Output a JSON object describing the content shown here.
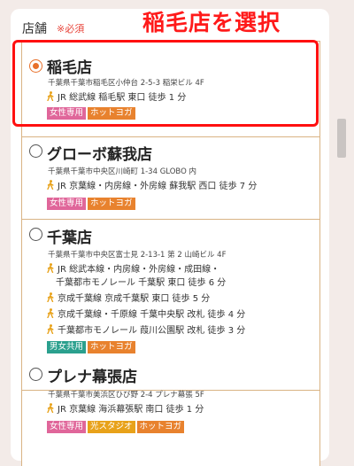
{
  "form": {
    "field_label": "店舗",
    "required_label": "※必須"
  },
  "annotation": "稲毛店を選択",
  "colors": {
    "tag_women": "#e0669a",
    "tag_yoga": "#e8822e",
    "tag_studio": "#e8a21a",
    "tag_mixed": "#2ba08e",
    "border": "#d9b384",
    "radio_selected": "#e8702a",
    "highlight": "#ff1010"
  },
  "stores": [
    {
      "name": "稲毛店",
      "selected": true,
      "address": "千葉県千葉市稲毛区小仲台 2-5-3 稲栄ビル 4F",
      "access": [
        {
          "text": "JR 総武線 稲毛駅 東口 徒歩 1 分",
          "walker": true
        }
      ],
      "tags": [
        {
          "label": "女性専用",
          "color": "tag_women"
        },
        {
          "label": "ホットヨガ",
          "color": "tag_yoga"
        }
      ]
    },
    {
      "name": "グローボ蘇我店",
      "selected": false,
      "address": "千葉県千葉市中央区川崎町 1-34 GLOBO 内",
      "access": [
        {
          "text": "JR 京葉線・内房線・外房線 蘇我駅 西口 徒歩 7 分",
          "walker": true
        }
      ],
      "tags": [
        {
          "label": "女性専用",
          "color": "tag_women"
        },
        {
          "label": "ホットヨガ",
          "color": "tag_yoga"
        }
      ]
    },
    {
      "name": "千葉店",
      "selected": false,
      "address": "千葉県千葉市中央区富士見 2-13-1 第 2 山崎ビル 4F",
      "access": [
        {
          "text": "JR 総武本線・内房線・外房線・成田線・",
          "walker": true
        },
        {
          "text": "千葉都市モノレール 千葉駅 東口 徒歩 6 分",
          "walker": false
        },
        {
          "text": "京成千葉線 京成千葉駅 東口 徒歩 5 分",
          "walker": true
        },
        {
          "text": "京成千葉線・千原線 千葉中央駅 改札 徒歩 4 分",
          "walker": true
        },
        {
          "text": "千葉都市モノレール 葭川公園駅 改札 徒歩 3 分",
          "walker": true
        }
      ],
      "tags": [
        {
          "label": "男女共用",
          "color": "tag_mixed"
        },
        {
          "label": "ホットヨガ",
          "color": "tag_yoga"
        }
      ]
    },
    {
      "name": "プレナ幕張店",
      "selected": false,
      "address": "千葉県千葉市美浜区ひび野 2-4 プレナ幕張 5F",
      "access": [
        {
          "text": "JR 京葉線 海浜幕張駅 南口 徒歩 1 分",
          "walker": true
        }
      ],
      "tags": [
        {
          "label": "女性専用",
          "color": "tag_women"
        },
        {
          "label": "光スタジオ",
          "color": "tag_studio"
        },
        {
          "label": "ホットヨガ",
          "color": "tag_yoga"
        }
      ]
    }
  ]
}
